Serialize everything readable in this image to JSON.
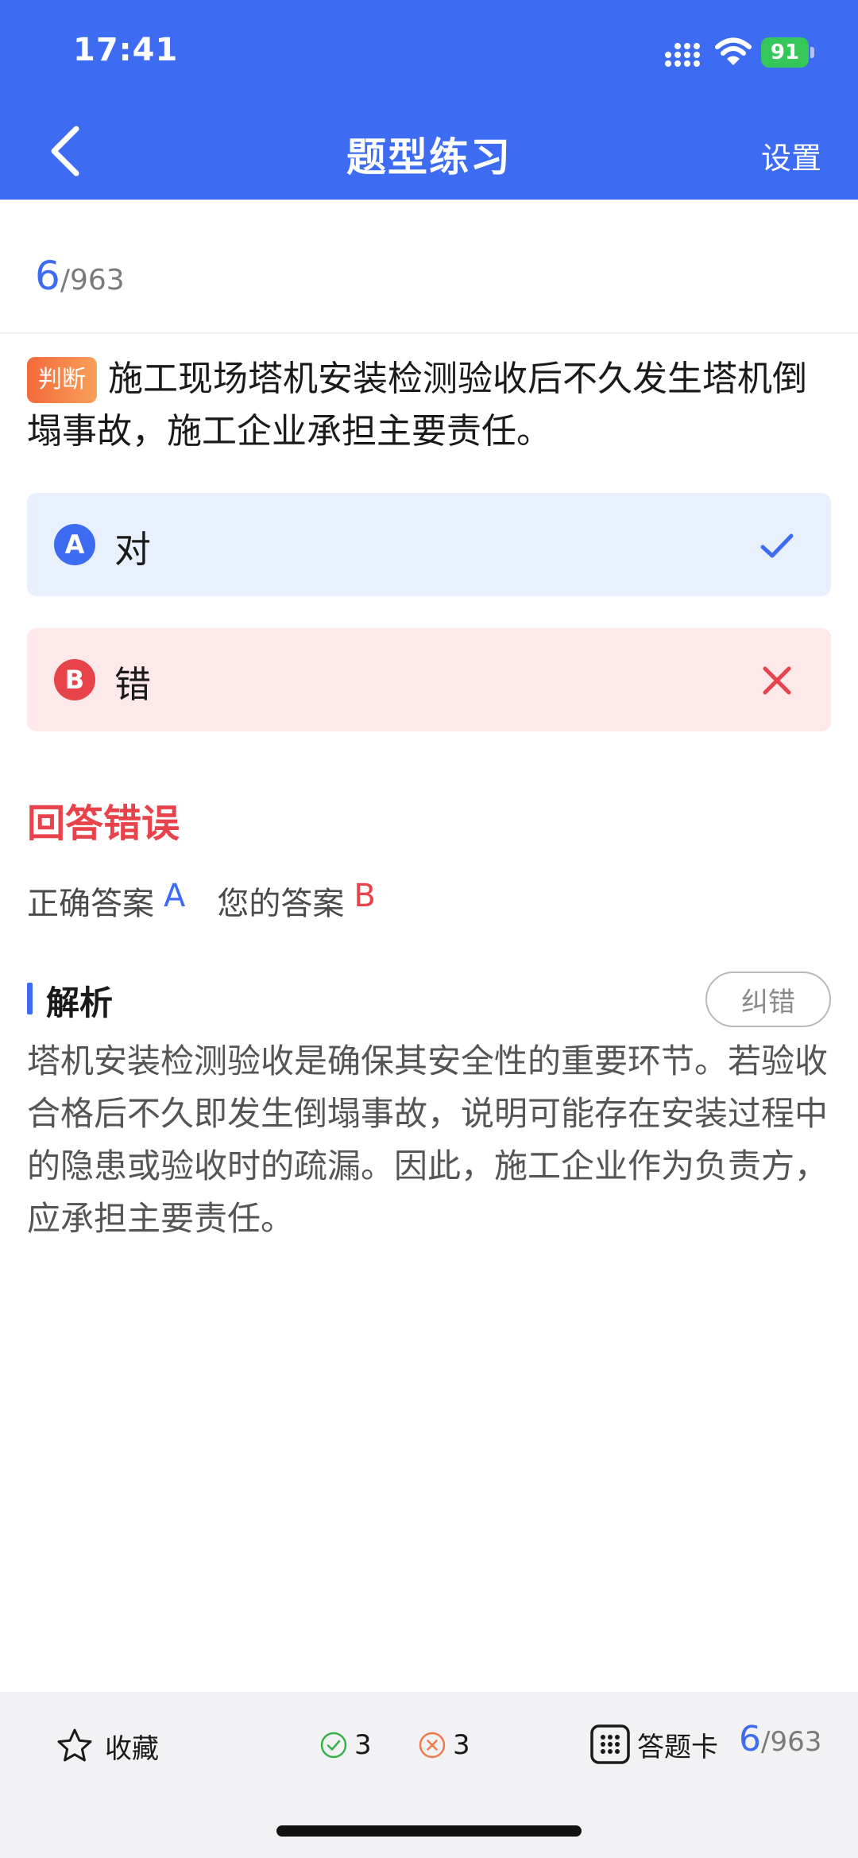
{
  "status_bar": {
    "time": "17:41",
    "battery": "91"
  },
  "nav": {
    "title": "题型练习",
    "settings_label": "设置"
  },
  "progress": {
    "current": "6",
    "total": "/963"
  },
  "question": {
    "type_badge": "判断",
    "text": "施工现场塔机安装检测验收后不久发生塔机倒塌事故，施工企业承担主要责任。"
  },
  "options": [
    {
      "letter": "A",
      "text": "对",
      "state": "correct"
    },
    {
      "letter": "B",
      "text": "错",
      "state": "wrong"
    }
  ],
  "result": {
    "title": "回答错误",
    "correct_label": "正确答案",
    "correct_value": "A",
    "your_label": "您的答案",
    "your_value": "B"
  },
  "analysis": {
    "title": "解析",
    "report_button": "纠错",
    "text": "塔机安装检测验收是确保其安全性的重要环节。若验收合格后不久即发生倒塌事故，说明可能存在安装过程中的隐患或验收时的疏漏。因此，施工企业作为负责方，应承担主要责任。"
  },
  "bottom_bar": {
    "favorite_label": "收藏",
    "correct_count": "3",
    "wrong_count": "3",
    "answer_card_label": "答题卡",
    "progress_current": "6",
    "progress_total": "/963"
  },
  "colors": {
    "primary": "#3d6cf2",
    "error": "#e8434a",
    "success": "#35c759",
    "badge_orange": "#f36a3b"
  },
  "icons": [
    "back-arrow-icon",
    "signal-icon",
    "wifi-icon",
    "battery-icon",
    "checkmark-icon",
    "cross-icon",
    "star-icon",
    "check-circle-icon",
    "x-circle-icon",
    "grid-icon"
  ]
}
